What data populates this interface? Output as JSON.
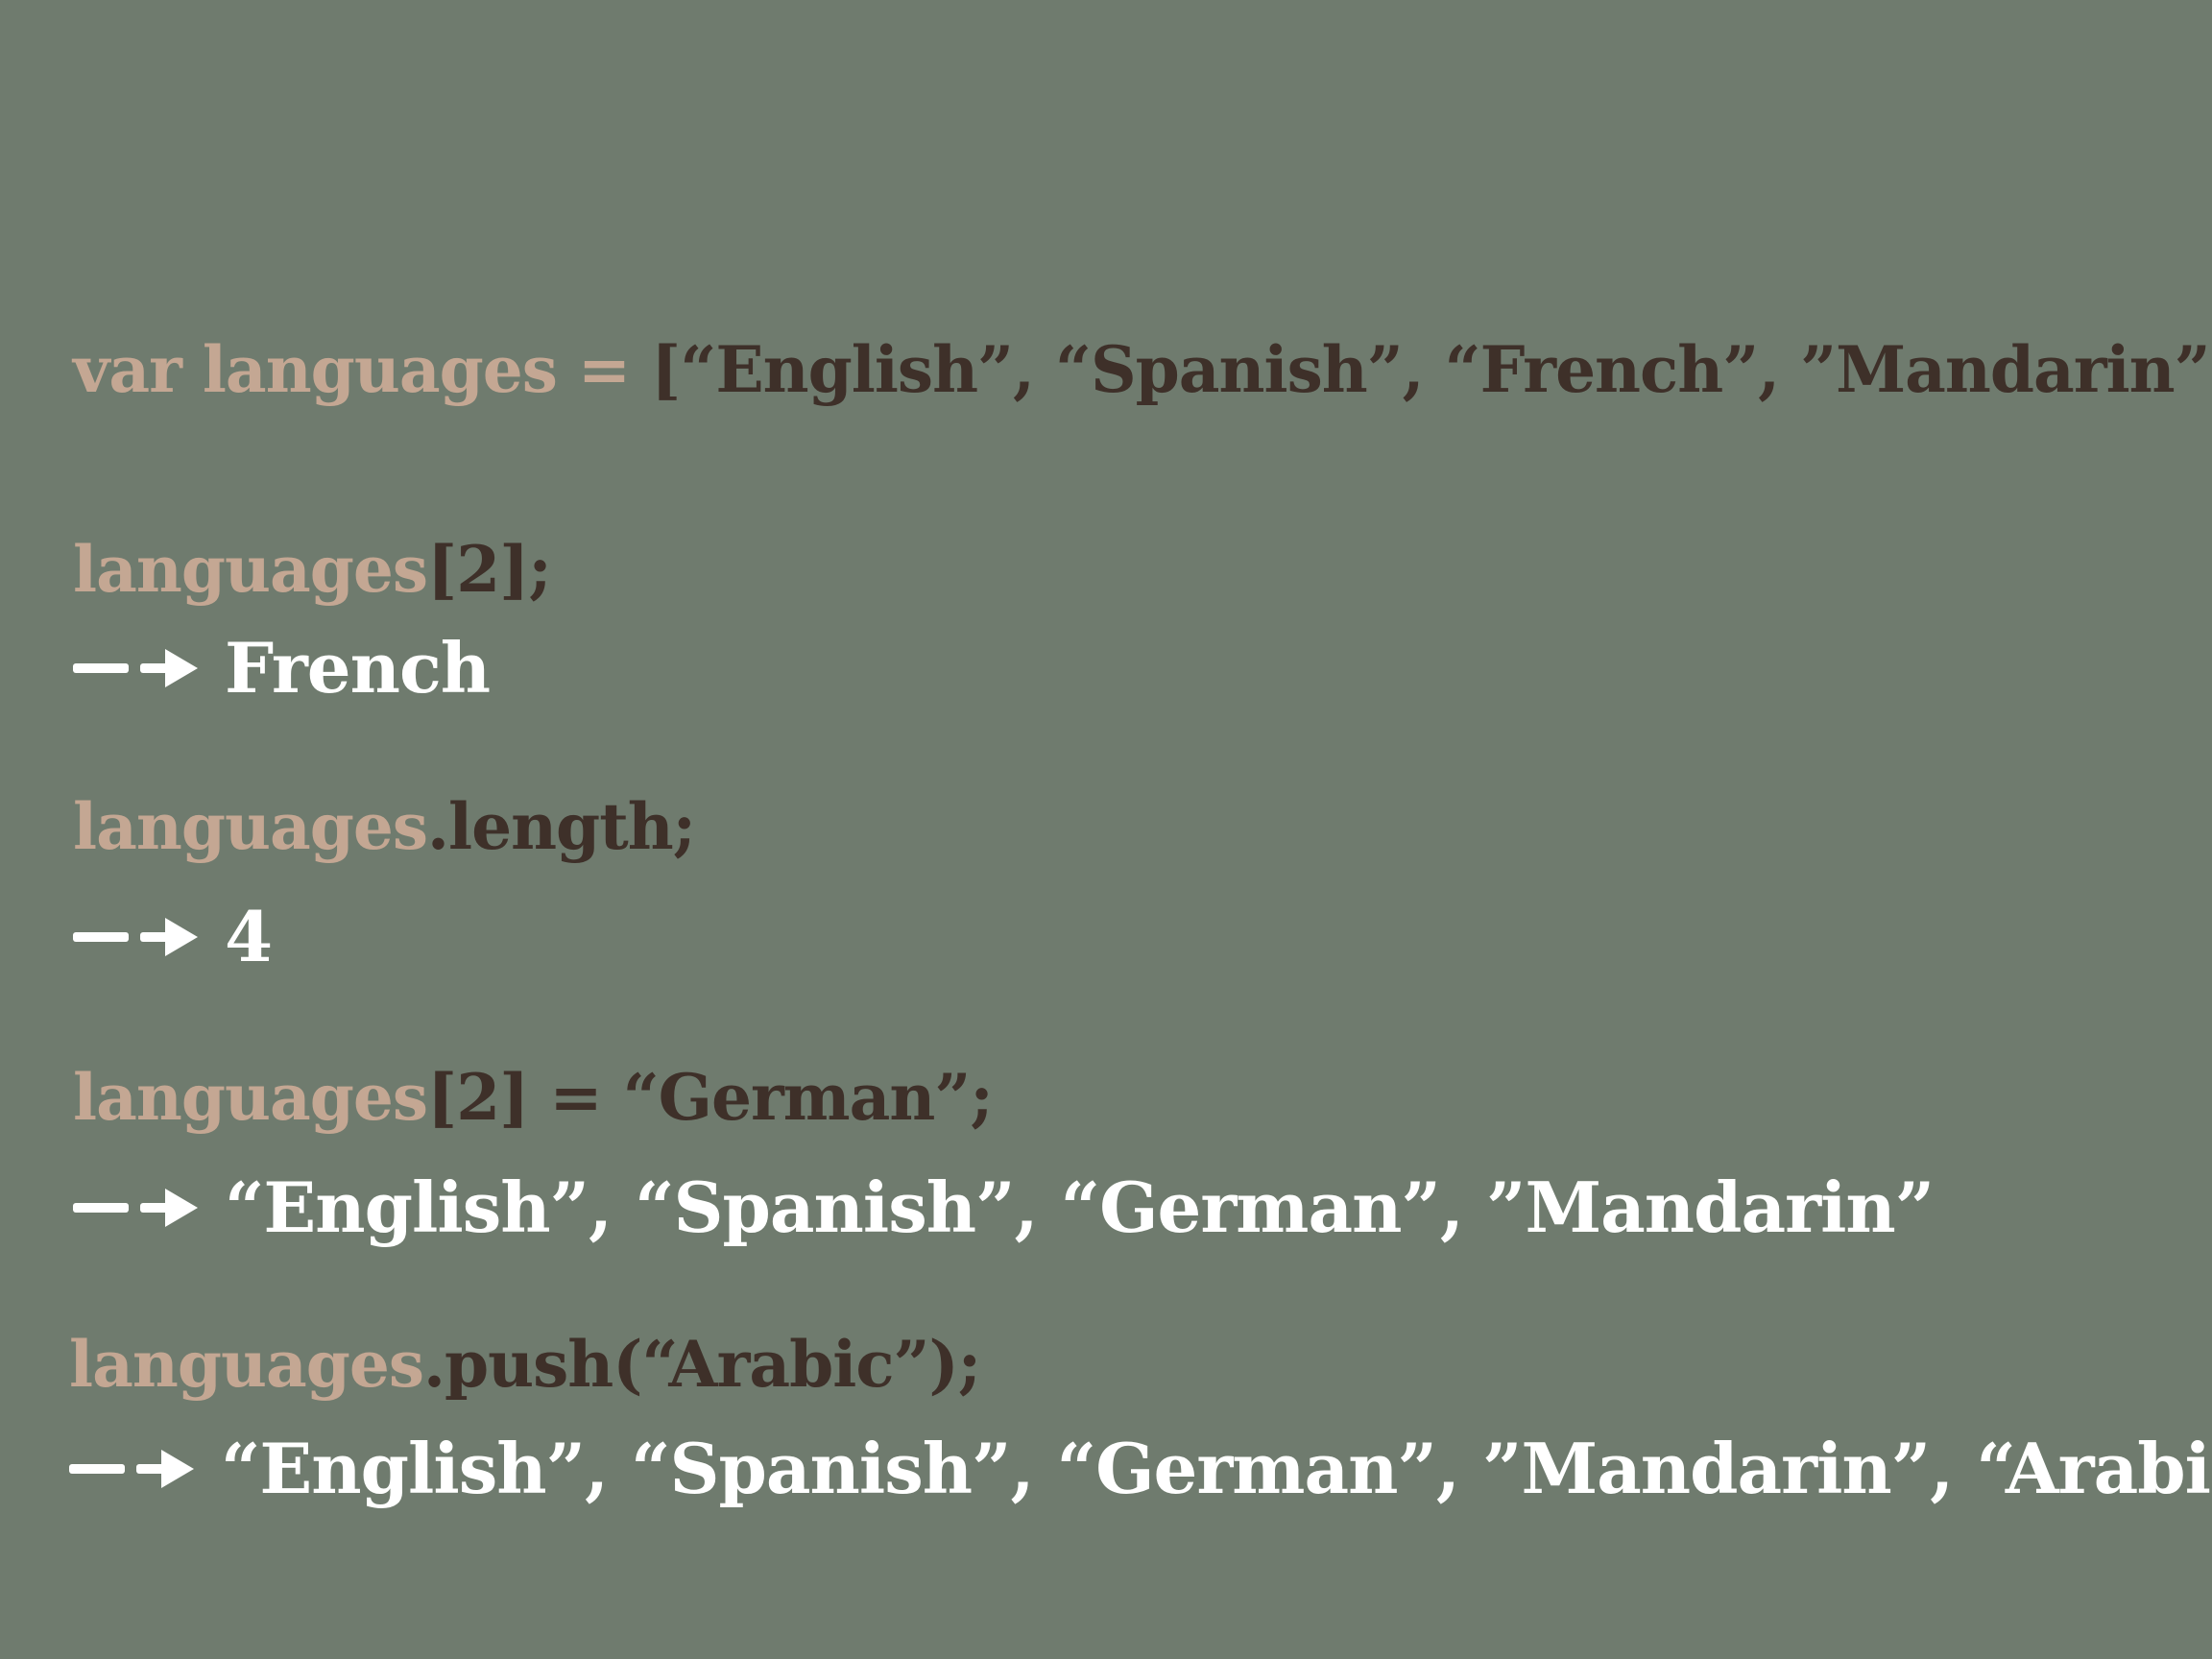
{
  "colors": {
    "background": "#6f7b6e",
    "identifier": "#c4a793",
    "code": "#3e3029",
    "result": "#ffffff"
  },
  "lines": {
    "declaration": {
      "keyword_part": "var languages = ",
      "value_part": "[“English”,  “Spanish”,  “French”, ”Mandarin”];"
    },
    "index_access": {
      "identifier": "languages",
      "rest": "[2];",
      "result": "French"
    },
    "length_access": {
      "identifier": "languages",
      "rest": ".length;",
      "result": "4"
    },
    "assignment": {
      "identifier": "languages",
      "rest_bracket": "[2]",
      "rest_eq": " = ",
      "rest_value": "“German”;",
      "result": "“English”,  “Spanish”,  “German”, ”Mandarin”"
    },
    "push_call": {
      "identifier": "languages",
      "rest": ".push(“Arabic”);",
      "result": "“English”,  “Spanish”,  “German”, ”Mandarin”, “Arabic”"
    }
  },
  "icons": {
    "result_arrow": "arrow-right-icon"
  }
}
